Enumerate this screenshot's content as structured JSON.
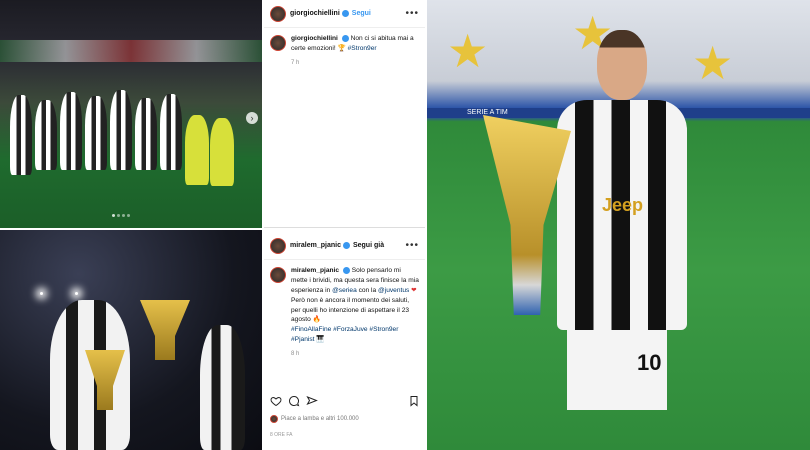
{
  "post1": {
    "username": "giorgiochiellini",
    "follow_label": "Segui",
    "caption_user": "giorgiochiellini",
    "caption_text": "Non ci si abitua mai a certe emozioni!",
    "caption_tag": "#Stron9er",
    "time": "7 h"
  },
  "post2": {
    "username": "miralem_pjanic",
    "follow_label": "Segui già",
    "caption_user": "miralem_pjanic",
    "caption_line1": "Solo pensarlo mi mette i brividi, ma questa sera finisce la mia esperienza in",
    "caption_tag_seriea": "@seriea",
    "caption_line1b": "con la",
    "caption_tag_juve": "@juventus",
    "caption_line2": "Però non è ancora il momento dei saluti, per quelli ho intenzione di aspettare il 23 agosto",
    "caption_hashtags": "#FinoAllaFine #ForzaJuve #Stron9er #Pjanist",
    "time": "8 h",
    "likes_text": "Piace a lamba e altri 100.000",
    "days_ago": "8 ORE FA"
  },
  "photo3": {
    "banner_text": "SERIE A TIM",
    "shirt_number": "10",
    "sponsor": "Jeep"
  },
  "colors": {
    "accent": "#3897f0",
    "juve_black": "#111111",
    "gold": "#e7c33b",
    "pitch": "#3c9b45"
  }
}
